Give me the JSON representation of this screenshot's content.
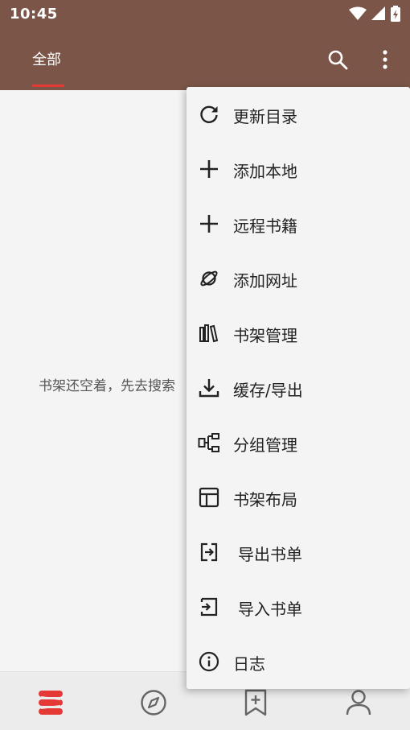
{
  "status_bar": {
    "time": "10:45"
  },
  "app_bar": {
    "tab_label": "全部"
  },
  "empty_state": {
    "text": "书架还空着，先去搜索"
  },
  "menu": {
    "items": [
      {
        "label": "更新目录",
        "icon": "refresh-icon"
      },
      {
        "label": "添加本地",
        "icon": "plus-icon"
      },
      {
        "label": "远程书籍",
        "icon": "plus-icon"
      },
      {
        "label": "添加网址",
        "icon": "planet-icon"
      },
      {
        "label": "书架管理",
        "icon": "books-icon"
      },
      {
        "label": "缓存/导出",
        "icon": "download-icon"
      },
      {
        "label": "分组管理",
        "icon": "group-icon"
      },
      {
        "label": "书架布局",
        "icon": "layout-icon"
      },
      {
        "label": "导出书单",
        "icon": "export-icon"
      },
      {
        "label": "导入书单",
        "icon": "import-icon"
      },
      {
        "label": "日志",
        "icon": "info-icon"
      }
    ]
  },
  "bottom_nav": {
    "items": [
      {
        "icon": "bookshelf-icon"
      },
      {
        "icon": "compass-icon"
      },
      {
        "icon": "bookmark-plus-icon"
      },
      {
        "icon": "person-icon"
      }
    ]
  },
  "colors": {
    "app_bar": "#7a5548",
    "accent": "#e53935",
    "menu_background": "#f4f4f4"
  }
}
